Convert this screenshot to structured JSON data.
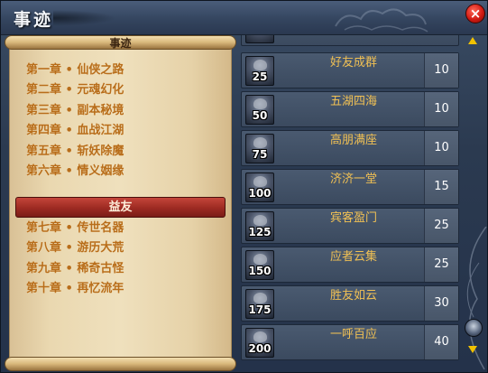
{
  "window": {
    "title": "事迹",
    "close_label": "×"
  },
  "scroll": {
    "title": "事迹",
    "chapters_upper": [
      "第一章 • 仙侠之路",
      "第二章 • 元魂幻化",
      "第三章 • 副本秘境",
      "第四章 • 血战江湖",
      "第五章 • 斩妖除魔",
      "第六章 • 情义姻缘"
    ],
    "selected": "益友",
    "chapters_lower": [
      "第七章 • 传世名器",
      "第八章 • 游历大荒",
      "第九章 • 稀奇古怪",
      "第十章 • 再忆流年"
    ]
  },
  "achievements": [
    {
      "badge": "25",
      "name": "好友成群",
      "points": "10"
    },
    {
      "badge": "50",
      "name": "五湖四海",
      "points": "10"
    },
    {
      "badge": "75",
      "name": "高朋满座",
      "points": "10"
    },
    {
      "badge": "100",
      "name": "济济一堂",
      "points": "15"
    },
    {
      "badge": "125",
      "name": "宾客盈门",
      "points": "25"
    },
    {
      "badge": "150",
      "name": "应者云集",
      "points": "25"
    },
    {
      "badge": "175",
      "name": "胜友如云",
      "points": "30"
    },
    {
      "badge": "200",
      "name": "一呼百应",
      "points": "40"
    }
  ],
  "colors": {
    "chapter_text": "#b86d1a",
    "achievement_name": "#f0c054",
    "selected_bg": "#9c2a22",
    "scroll_arrow": "#f2c200",
    "close_button": "#d21a12"
  },
  "icons": {
    "close": "close-icon",
    "scroll_up": "arrow-up-icon",
    "scroll_down": "arrow-down-icon",
    "badge": "avatar-badge-icon"
  }
}
